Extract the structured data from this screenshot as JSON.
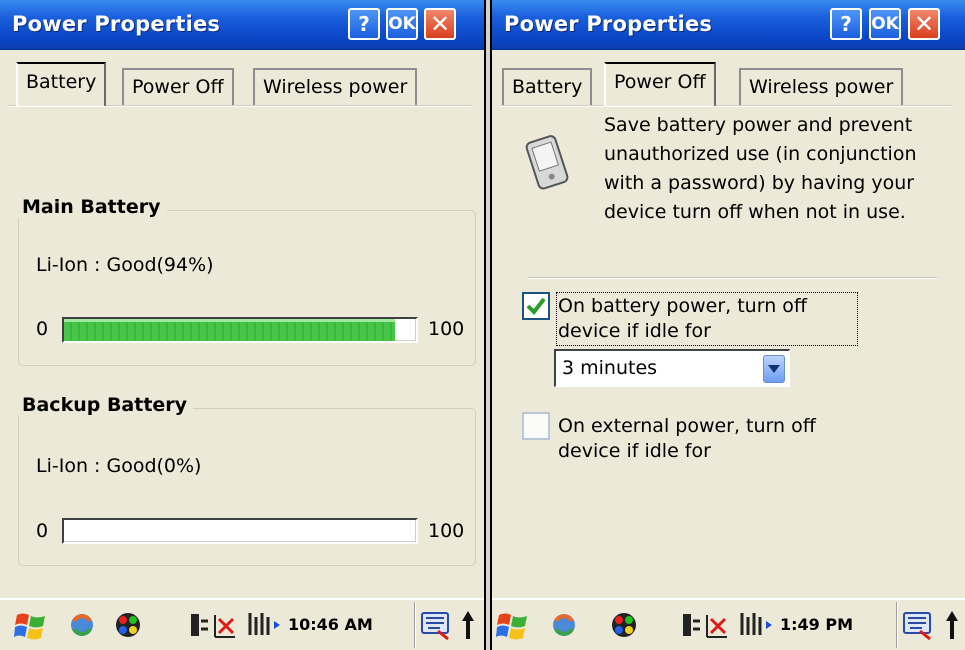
{
  "left": {
    "title": "Power Properties",
    "buttons": {
      "help": "?",
      "ok": "OK",
      "close": "✕"
    },
    "tabs": [
      "Battery",
      "Power Off",
      "Wireless power"
    ],
    "active_tab": "Battery",
    "main_battery": {
      "heading": "Main Battery",
      "status": "Li-Ion : Good(94%)",
      "min_label": "0",
      "max_label": "100",
      "level_percent": 94
    },
    "backup_battery": {
      "heading": "Backup Battery",
      "status": "Li-Ion : Good(0%)",
      "min_label": "0",
      "max_label": "100",
      "level_percent": 0
    },
    "taskbar": {
      "clock": "10:46 AM"
    }
  },
  "right": {
    "title": "Power Properties",
    "buttons": {
      "help": "?",
      "ok": "OK",
      "close": "✕"
    },
    "tabs": [
      "Battery",
      "Power Off",
      "Wireless power"
    ],
    "active_tab": "Power Off",
    "description": "Save battery power and prevent unauthorized use (in conjunction with a password) by having your device turn off when not in use.",
    "battery_option": {
      "label_line1": "On battery power, turn off",
      "label_line2": "device if idle for",
      "checked": true,
      "selected_value": "3 minutes"
    },
    "external_option": {
      "label_line1": "On external power, turn off",
      "label_line2": "device if idle for",
      "checked": false
    },
    "taskbar": {
      "clock": "1:49 PM"
    }
  },
  "colors": {
    "titlebar": "#0b47c8",
    "window_bg": "#ece9d8",
    "progress_fill": "#46c646",
    "close_button": "#d8401e"
  }
}
